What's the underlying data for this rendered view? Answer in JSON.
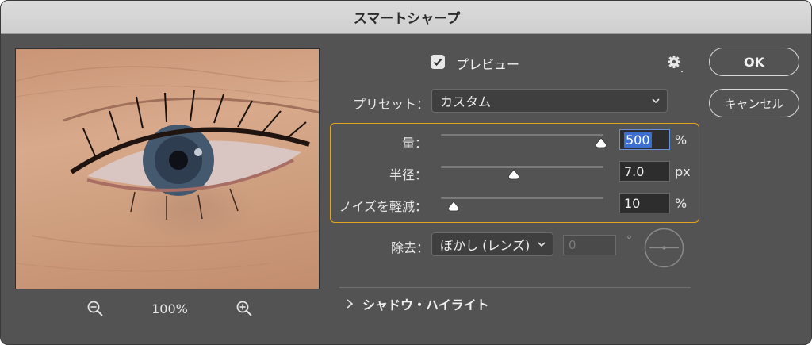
{
  "window": {
    "title": "スマートシャープ"
  },
  "preview_panel": {
    "zoom_level": "100%",
    "zoom_out_icon": "zoom-out-icon",
    "zoom_in_icon": "zoom-in-icon"
  },
  "preview_toggle": {
    "label": "プレビュー",
    "checked": true
  },
  "gear_icon": "gear-icon",
  "buttons": {
    "ok": "OK",
    "cancel": "キャンセル"
  },
  "preset": {
    "label": "プリセット：",
    "value": "カスタム"
  },
  "sliders": [
    {
      "label": "量：",
      "value": "500",
      "unit": "%",
      "fraction": 0.985
    },
    {
      "label": "半径：",
      "value": "7.0",
      "unit": "px",
      "fraction": 0.45
    },
    {
      "label": "ノイズを軽減：",
      "value": "10",
      "unit": "%",
      "fraction": 0.08
    }
  ],
  "remove": {
    "label": "除去：",
    "value": "ぼかし (レンズ)",
    "angle_value": "0",
    "angle_unit": "°"
  },
  "shadow_highlight": {
    "label": "シャドウ・ハイライト"
  },
  "colors": {
    "accent_group_border": "#e4a31f",
    "selection": "#3d6fd1",
    "window_bg": "#535353"
  }
}
